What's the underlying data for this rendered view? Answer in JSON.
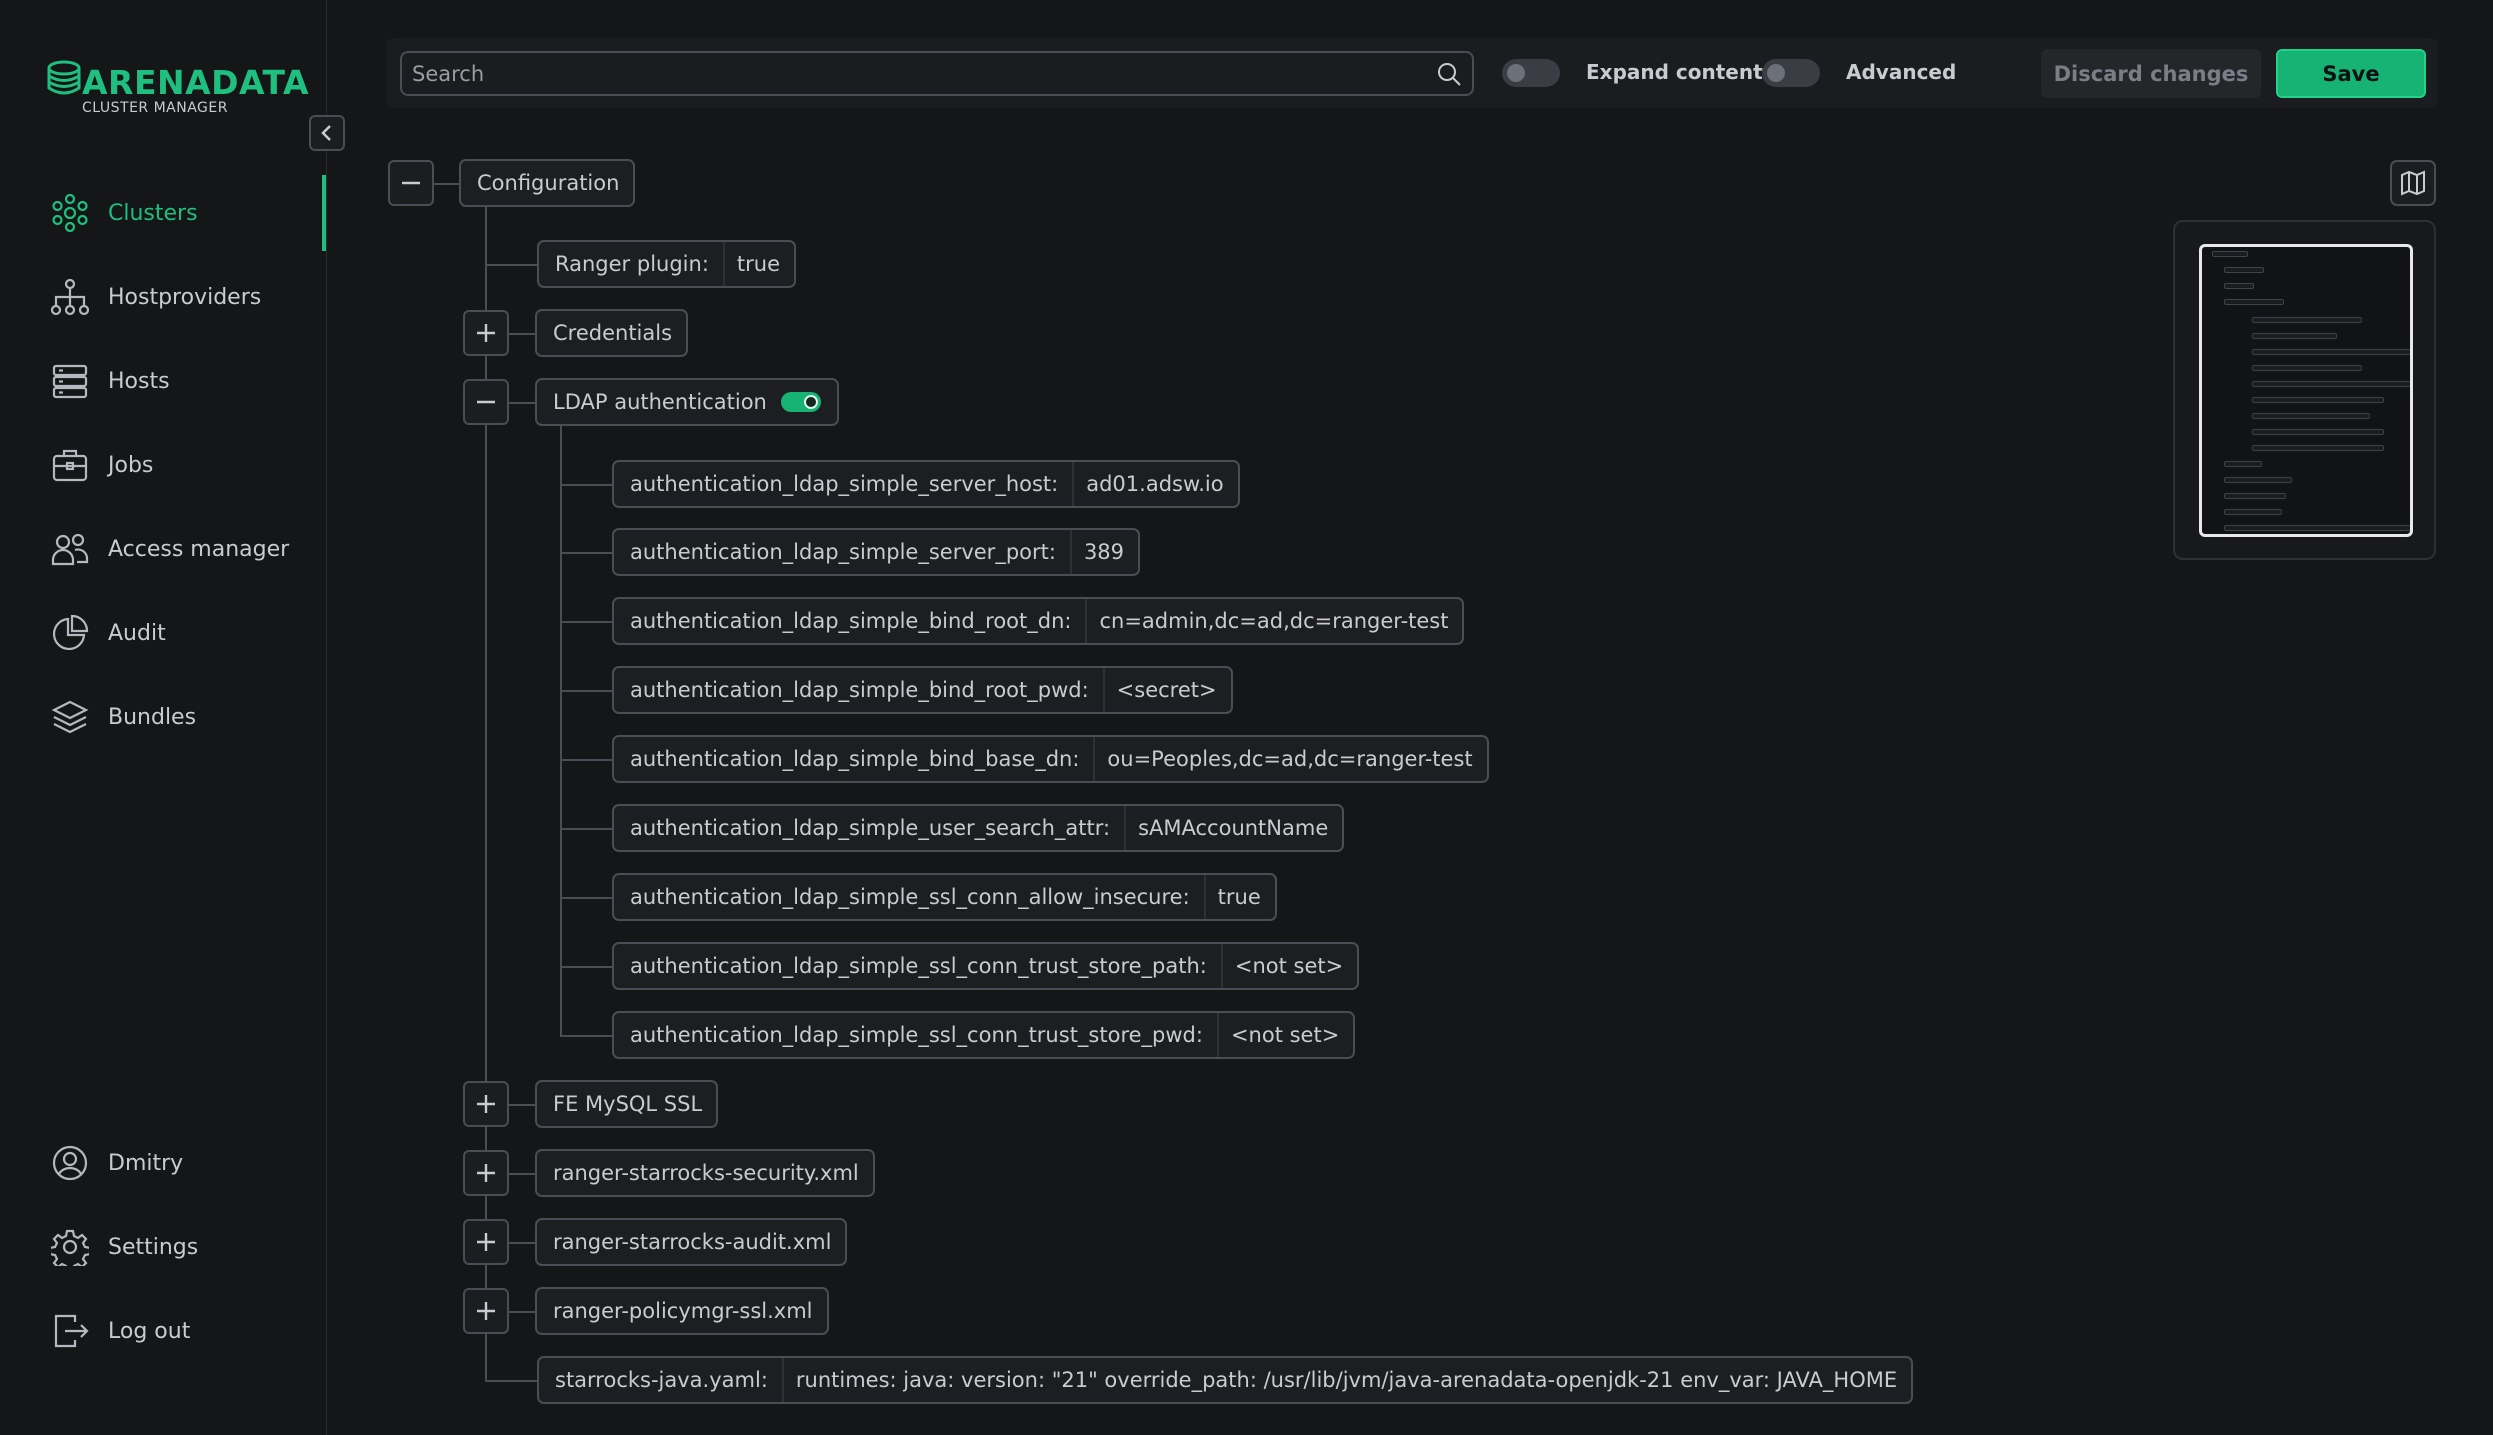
{
  "sidebar": {
    "logo": {
      "title": "ARENADATA",
      "subtitle": "CLUSTER MANAGER"
    },
    "nav": [
      {
        "label": "Clusters",
        "icon": "clusters-icon",
        "active": true
      },
      {
        "label": "Hostproviders",
        "icon": "hostproviders-icon"
      },
      {
        "label": "Hosts",
        "icon": "hosts-icon"
      },
      {
        "label": "Jobs",
        "icon": "jobs-icon"
      },
      {
        "label": "Access manager",
        "icon": "access-manager-icon"
      },
      {
        "label": "Audit",
        "icon": "audit-icon"
      },
      {
        "label": "Bundles",
        "icon": "bundles-icon"
      }
    ],
    "bottom": [
      {
        "label": "Dmitry",
        "icon": "user-icon"
      },
      {
        "label": "Settings",
        "icon": "settings-icon"
      },
      {
        "label": "Log out",
        "icon": "logout-icon"
      }
    ]
  },
  "toolbar": {
    "search_placeholder": "Search",
    "expand_content_label": "Expand content",
    "advanced_label": "Advanced",
    "discard_label": "Discard changes",
    "save_label": "Save"
  },
  "colors": {
    "accent": "#1fbf7f",
    "background": "#151618",
    "border": "#4a4d54"
  },
  "tree": {
    "root": "Configuration",
    "ranger_plugin": {
      "key": "Ranger plugin:",
      "value": "true"
    },
    "credentials": "Credentials",
    "ldap": {
      "label": "LDAP authentication",
      "enabled": true,
      "fields": [
        {
          "key": "authentication_ldap_simple_server_host:",
          "value": "ad01.adsw.io"
        },
        {
          "key": "authentication_ldap_simple_server_port:",
          "value": "389"
        },
        {
          "key": "authentication_ldap_simple_bind_root_dn:",
          "value": "cn=admin,dc=ad,dc=ranger-test"
        },
        {
          "key": "authentication_ldap_simple_bind_root_pwd:",
          "value": "<secret>"
        },
        {
          "key": "authentication_ldap_simple_bind_base_dn:",
          "value": "ou=Peoples,dc=ad,dc=ranger-test"
        },
        {
          "key": "authentication_ldap_simple_user_search_attr:",
          "value": "sAMAccountName"
        },
        {
          "key": "authentication_ldap_simple_ssl_conn_allow_insecure:",
          "value": "true"
        },
        {
          "key": "authentication_ldap_simple_ssl_conn_trust_store_path:",
          "value": "<not set>"
        },
        {
          "key": "authentication_ldap_simple_ssl_conn_trust_store_pwd:",
          "value": "<not set>"
        }
      ]
    },
    "fe_mysql_ssl": "FE MySQL SSL",
    "ranger_security": "ranger-starrocks-security.xml",
    "ranger_audit": "ranger-starrocks-audit.xml",
    "ranger_policymgr": "ranger-policymgr-ssl.xml",
    "java_yaml": {
      "key": "starrocks-java.yaml:",
      "value": "runtimes: java: version: \"21\" override_path: /usr/lib/jvm/java-arenadata-openjdk-21 env_var: JAVA_HOME"
    }
  }
}
